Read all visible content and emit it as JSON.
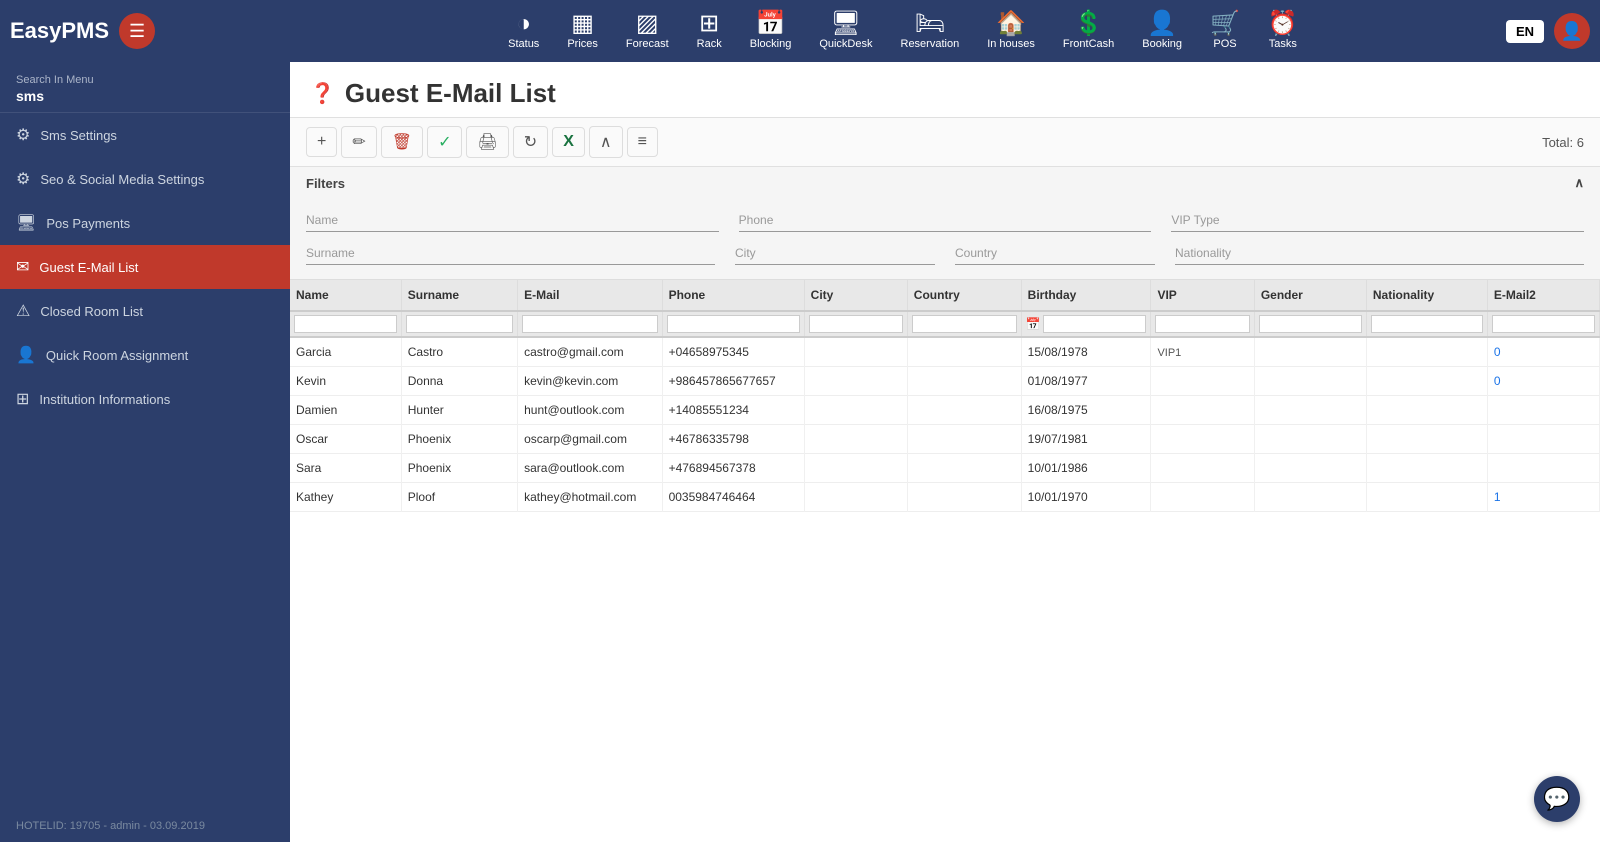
{
  "app": {
    "name": "EasyPMS"
  },
  "topnav": {
    "items": [
      {
        "id": "status",
        "label": "Status",
        "icon": "◑"
      },
      {
        "id": "prices",
        "label": "Prices",
        "icon": "▦"
      },
      {
        "id": "forecast",
        "label": "Forecast",
        "icon": "▨"
      },
      {
        "id": "rack",
        "label": "Rack",
        "icon": "⊞"
      },
      {
        "id": "blocking",
        "label": "Blocking",
        "icon": "📅"
      },
      {
        "id": "quickdesk",
        "label": "QuickDesk",
        "icon": "🖥"
      },
      {
        "id": "reservation",
        "label": "Reservation",
        "icon": "🛏"
      },
      {
        "id": "inhouses",
        "label": "In houses",
        "icon": "💲"
      },
      {
        "id": "frontcash",
        "label": "FrontCash",
        "icon": "💲"
      },
      {
        "id": "booking",
        "label": "Booking",
        "icon": "👤"
      },
      {
        "id": "pos",
        "label": "POS",
        "icon": "🛒"
      },
      {
        "id": "tasks",
        "label": "Tasks",
        "icon": "⏰"
      }
    ],
    "language": "EN"
  },
  "sidebar": {
    "search_label": "Search In Menu",
    "search_value": "sms",
    "items": [
      {
        "id": "sms-settings",
        "label": "Sms Settings",
        "icon": "⚙",
        "active": false
      },
      {
        "id": "seo-social",
        "label": "Seo & Social Media Settings",
        "icon": "⚙",
        "active": false
      },
      {
        "id": "pos-payments",
        "label": "Pos Payments",
        "icon": "🖥",
        "active": false
      },
      {
        "id": "guest-email",
        "label": "Guest E-Mail List",
        "icon": "✉",
        "active": true
      },
      {
        "id": "closed-room",
        "label": "Closed Room List",
        "icon": "⚠",
        "active": false
      },
      {
        "id": "quick-room",
        "label": "Quick Room Assignment",
        "icon": "👤",
        "active": false
      },
      {
        "id": "institution",
        "label": "Institution Informations",
        "icon": "⊞",
        "active": false
      }
    ],
    "footer": "HOTELID: 19705 - admin - 03.09.2019"
  },
  "page": {
    "title": "Guest E-Mail List",
    "total_label": "Total: 6"
  },
  "toolbar": {
    "add": "+",
    "edit": "✏",
    "delete": "🗑",
    "check": "✓",
    "print": "🖨",
    "refresh": "↻",
    "excel": "X",
    "collapse": "∧",
    "menu": "≡"
  },
  "filters": {
    "label": "Filters",
    "name_placeholder": "Name",
    "phone_placeholder": "Phone",
    "vip_placeholder": "VIP Type",
    "surname_placeholder": "Surname",
    "city_placeholder": "City",
    "country_placeholder": "Country",
    "nationality_placeholder": "Nationality"
  },
  "table": {
    "columns": [
      "Name",
      "Surname",
      "E-Mail",
      "Phone",
      "City",
      "Country",
      "Birthday",
      "VIP",
      "Gender",
      "Nationality",
      "E-Mail2"
    ],
    "rows": [
      {
        "name": "Garcia",
        "surname": "Castro",
        "email": "castro@gmail.com",
        "phone": "+04658975345",
        "city": "",
        "country": "",
        "birthday": "15/08/1978",
        "vip": "VIP1",
        "gender": "",
        "nationality": "",
        "email2": "0"
      },
      {
        "name": "Kevin",
        "surname": "Donna",
        "email": "kevin@kevin.com",
        "phone": "+986457865677657",
        "city": "",
        "country": "",
        "birthday": "01/08/1977",
        "vip": "",
        "gender": "",
        "nationality": "",
        "email2": "0"
      },
      {
        "name": "Damien",
        "surname": "Hunter",
        "email": "hunt@outlook.com",
        "phone": "+14085551234",
        "city": "",
        "country": "",
        "birthday": "16/08/1975",
        "vip": "",
        "gender": "",
        "nationality": "",
        "email2": ""
      },
      {
        "name": "Oscar",
        "surname": "Phoenix",
        "email": "oscarp@gmail.com",
        "phone": "+46786335798",
        "city": "",
        "country": "",
        "birthday": "19/07/1981",
        "vip": "",
        "gender": "",
        "nationality": "",
        "email2": ""
      },
      {
        "name": "Sara",
        "surname": "Phoenix",
        "email": "sara@outlook.com",
        "phone": "+476894567378",
        "city": "",
        "country": "",
        "birthday": "10/01/1986",
        "vip": "",
        "gender": "",
        "nationality": "",
        "email2": ""
      },
      {
        "name": "Kathey",
        "surname": "Ploof",
        "email": "kathey@hotmail.com",
        "phone": "0035984746464",
        "city": "",
        "country": "",
        "birthday": "10/01/1970",
        "vip": "",
        "gender": "",
        "nationality": "",
        "email2": "1"
      }
    ]
  }
}
